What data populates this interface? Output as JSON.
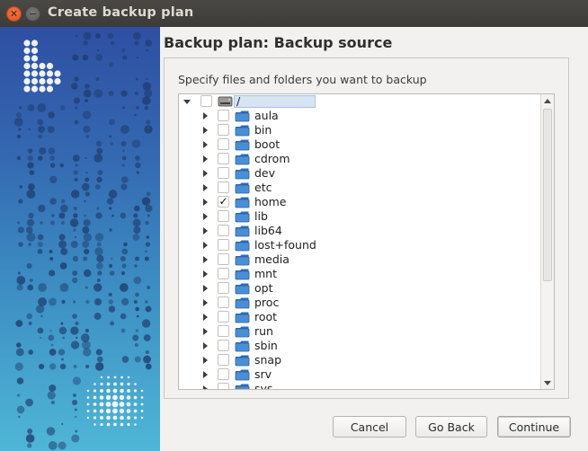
{
  "window": {
    "title": "Create backup plan"
  },
  "header": {
    "title": "Backup plan: Backup source"
  },
  "source": {
    "instruction": "Specify files and folders you want to backup",
    "root": {
      "label": "/",
      "expanded": true,
      "checked": false,
      "icon": "drive-icon"
    },
    "items": [
      {
        "label": "aula",
        "checked": false
      },
      {
        "label": "bin",
        "checked": false
      },
      {
        "label": "boot",
        "checked": false
      },
      {
        "label": "cdrom",
        "checked": false
      },
      {
        "label": "dev",
        "checked": false
      },
      {
        "label": "etc",
        "checked": false
      },
      {
        "label": "home",
        "checked": true
      },
      {
        "label": "lib",
        "checked": false
      },
      {
        "label": "lib64",
        "checked": false
      },
      {
        "label": "lost+found",
        "checked": false
      },
      {
        "label": "media",
        "checked": false
      },
      {
        "label": "mnt",
        "checked": false
      },
      {
        "label": "opt",
        "checked": false
      },
      {
        "label": "proc",
        "checked": false
      },
      {
        "label": "root",
        "checked": false
      },
      {
        "label": "run",
        "checked": false
      },
      {
        "label": "sbin",
        "checked": false
      },
      {
        "label": "snap",
        "checked": false
      },
      {
        "label": "srv",
        "checked": false
      },
      {
        "label": "sys",
        "checked": false
      }
    ]
  },
  "buttons": {
    "cancel": "Cancel",
    "back": "Go Back",
    "continue": "Continue"
  },
  "colors": {
    "folder": "#4a8fd6",
    "titlebar": "#3c3b37",
    "close": "#e95420",
    "panel_top": "#2f4fa2",
    "panel_bottom": "#4fb6d6"
  }
}
